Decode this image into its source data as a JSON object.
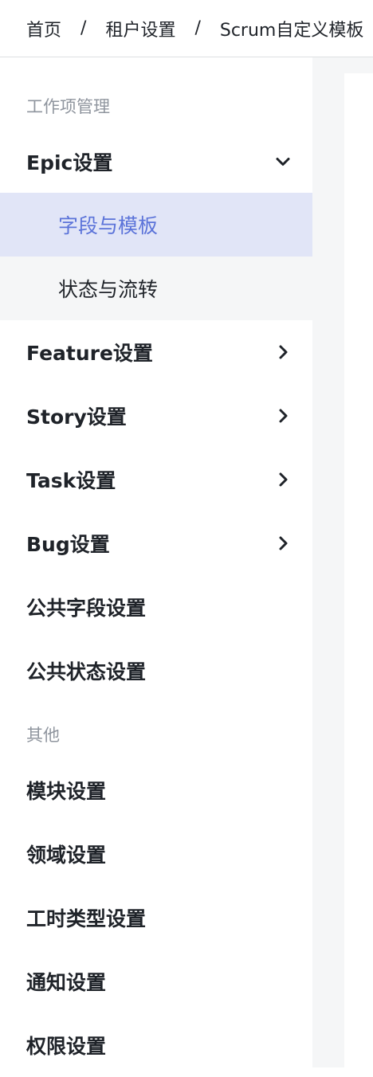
{
  "breadcrumb": {
    "items": [
      "首页",
      "租户设置",
      "Scrum自定义模板"
    ],
    "separator": "/"
  },
  "sidebar": {
    "groups": [
      {
        "title": "工作项管理",
        "items": [
          {
            "label": "Epic设置",
            "expanded": true,
            "chevron": "chevron-down-icon",
            "children": [
              {
                "label": "字段与模板",
                "active": true
              },
              {
                "label": "状态与流转",
                "active": false
              }
            ]
          },
          {
            "label": "Feature设置",
            "expanded": false,
            "chevron": "chevron-right-icon"
          },
          {
            "label": "Story设置",
            "expanded": false,
            "chevron": "chevron-right-icon"
          },
          {
            "label": "Task设置",
            "expanded": false,
            "chevron": "chevron-right-icon"
          },
          {
            "label": "Bug设置",
            "expanded": false,
            "chevron": "chevron-right-icon"
          },
          {
            "label": "公共字段设置"
          },
          {
            "label": "公共状态设置"
          }
        ]
      },
      {
        "title": "其他",
        "items": [
          {
            "label": "模块设置"
          },
          {
            "label": "领域设置"
          },
          {
            "label": "工时类型设置"
          },
          {
            "label": "通知设置"
          },
          {
            "label": "权限设置"
          }
        ]
      }
    ]
  },
  "colors": {
    "active_bg": "#e1e5f7",
    "active_text": "#5b73d9",
    "submenu_bg": "#f5f6f7",
    "group_title": "#8f959e",
    "text": "#1f2329",
    "content_bg": "#f5f6f7"
  }
}
